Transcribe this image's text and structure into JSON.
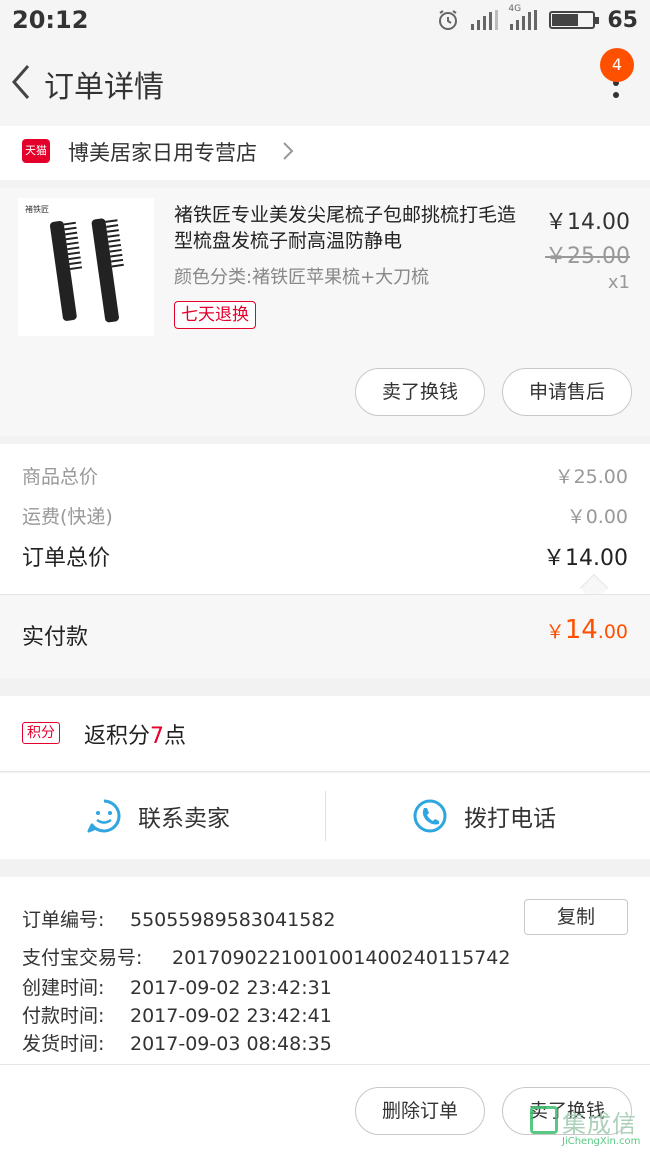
{
  "status_bar": {
    "time": "20:12",
    "battery": "65",
    "battery_level": 0.65,
    "network": "4G"
  },
  "nav": {
    "title": "订单详情",
    "badge_count": "4"
  },
  "shop": {
    "name": "博美居家日用专营店",
    "platform_badge": "天猫"
  },
  "product": {
    "image_brand": "褚铁匠",
    "title": "褚铁匠专业美发尖尾梳子包邮挑梳打毛造型梳盘发梳子耐高温防静电",
    "sku": "颜色分类:褚铁匠苹果梳+大刀梳",
    "return_tag": "七天退换",
    "price": "￥14.00",
    "original_price": "￥25.00",
    "quantity": "x1",
    "actions": {
      "sell_label": "卖了换钱",
      "after_sales_label": "申请售后"
    }
  },
  "price_summary": {
    "items_total_label": "商品总价",
    "items_total_value": "￥25.00",
    "shipping_label": "运费(快递)",
    "shipping_value": "￥0.00",
    "order_total_label": "订单总价",
    "order_total_value": "￥14.00"
  },
  "paid": {
    "label": "实付款",
    "currency": "￥",
    "integer": "14",
    "decimal": ".00"
  },
  "points": {
    "tag": "积分",
    "prefix": "返积分",
    "value": "7",
    "suffix": "点"
  },
  "contact": {
    "seller_label": "联系卖家",
    "phone_label": "拨打电话"
  },
  "order_info": {
    "order_no_label": "订单编号:",
    "order_no": "55055989583041582",
    "copy_label": "复制",
    "alipay_label": "支付宝交易号:",
    "alipay_no": "2017090221001001400240115742",
    "created_label": "创建时间:",
    "created_time": "2017-09-02 23:42:31",
    "paid_label": "付款时间:",
    "paid_time": "2017-09-02 23:42:41",
    "shipped_label": "发货时间:",
    "shipped_time": "2017-09-03 08:48:35"
  },
  "bottom_bar": {
    "delete_label": "删除订单",
    "sell_label": "卖了换钱"
  },
  "watermark": {
    "cn": "集成信",
    "en": "JiChengXin.com"
  },
  "colors": {
    "accent": "#ff5000",
    "tmall_red": "#e4002b",
    "icon_blue": "#2fa6e0"
  }
}
